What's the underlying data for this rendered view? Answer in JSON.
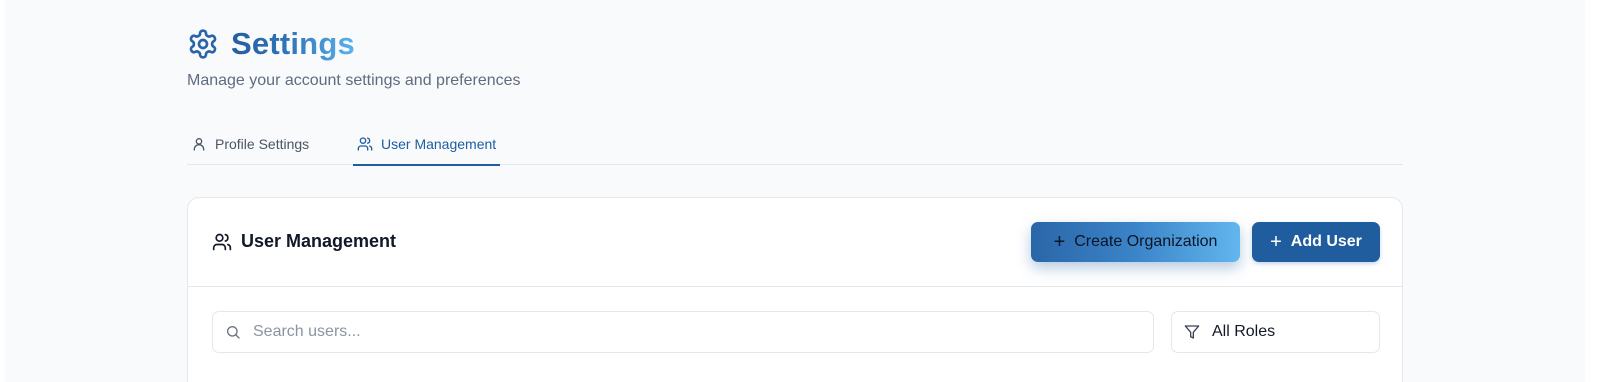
{
  "header": {
    "title": "Settings",
    "subtitle": "Manage your account settings and preferences",
    "icon": "gear-icon"
  },
  "tabs": [
    {
      "label": "Profile Settings",
      "icon": "user-icon",
      "active": false
    },
    {
      "label": "User Management",
      "icon": "users-icon",
      "active": true
    }
  ],
  "card": {
    "title": "User Management",
    "icon": "users-icon",
    "create_org_label": "Create Organization",
    "add_user_label": "Add User"
  },
  "filters": {
    "search_placeholder": "Search users...",
    "search_value": "",
    "role_selected": "All Roles"
  },
  "colors": {
    "accent": "#1f5d9e",
    "gradient_start": "#2a66a8",
    "gradient_end": "#62b6ee",
    "background": "#f8fafc"
  }
}
